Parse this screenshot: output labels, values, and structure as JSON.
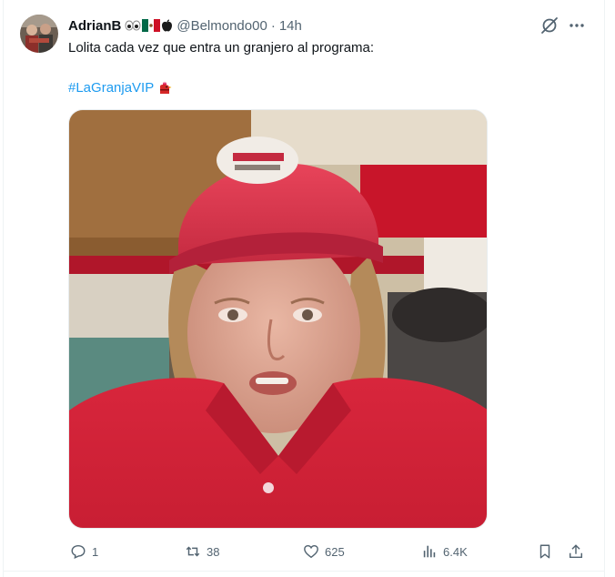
{
  "tweet": {
    "display_name": "AdrianB",
    "handle": "@Belmondo00",
    "separator": "·",
    "time": "14h",
    "text": "Lolita cada vez que entra un granjero al programa:",
    "hashtag": "#LaGranjaVIP",
    "name_emoji_icons": [
      "eyes-emoji-icon",
      "mexico-flag-emoji-icon",
      "apple-emoji-icon"
    ],
    "hashtag_emoji_icon": "red-rooster-emoji-icon"
  },
  "actions": {
    "replies": "1",
    "reposts": "38",
    "likes": "625",
    "views": "6.4K"
  },
  "colors": {
    "link": "#1d9bf0",
    "text_primary": "#0f1419",
    "text_secondary": "#536471"
  }
}
